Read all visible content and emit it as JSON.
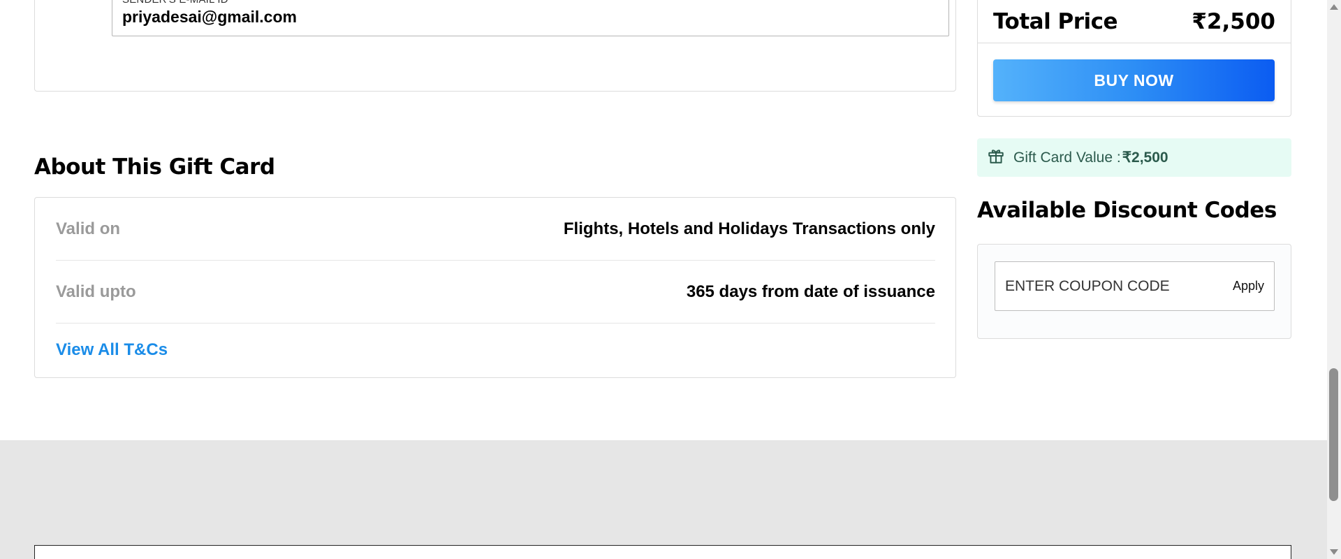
{
  "sender": {
    "email_label": "SENDER'S E-MAIL ID",
    "email_value": "priyadesai@gmail.com"
  },
  "about": {
    "title": "About This Gift Card",
    "rows": [
      {
        "key": "Valid on",
        "value": "Flights, Hotels and Holidays Transactions only"
      },
      {
        "key": "Valid upto",
        "value": "365 days from date of issuance"
      }
    ],
    "tc_link": "View All T&Cs"
  },
  "price": {
    "label": "Total Price",
    "value": "₹2,500",
    "buy_label": "BUY NOW"
  },
  "gift_card_value": {
    "label": "Gift Card Value :",
    "amount": "₹2,500"
  },
  "discount": {
    "title": "Available Discount Codes",
    "coupon_placeholder": "ENTER COUPON CODE",
    "apply_label": "Apply"
  },
  "colors": {
    "accent_link": "#1a8ce8",
    "buy_gradient_start": "#54b2fb",
    "buy_gradient_end": "#0b5cf2",
    "gift_value_bg": "#e6fbf4"
  }
}
